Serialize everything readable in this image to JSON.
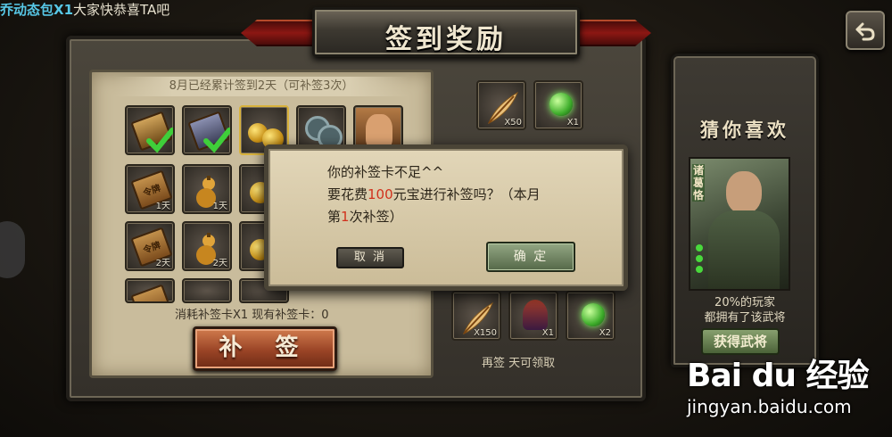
{
  "marquee": {
    "highlight": "乔动态包X1",
    "message": "大家快恭喜TA吧"
  },
  "title": "签到奖励",
  "checkin": {
    "banner": "8月已经累计签到2天（可补签3次）",
    "days": [
      "1天",
      "1天",
      "2天",
      "2天"
    ],
    "consume": "消耗补签卡X1  现有补签卡：0",
    "patch_button": "补 签"
  },
  "rewards": {
    "top_counts": [
      "X50",
      "X1"
    ],
    "bottom_counts": [
      "X150",
      "X1",
      "X2"
    ],
    "note": "再签  天可领取"
  },
  "side": {
    "title": "猜你喜欢",
    "hero_name": "诸葛恪",
    "percent_line1": "20%的玩家",
    "percent_line2": "都拥有了该武将",
    "get_button": "获得武将"
  },
  "dialog": {
    "line1": "你的补签卡不足^^",
    "line2_pre": "要花费",
    "line2_amount": "100",
    "line2_post": "元宝进行补签吗？（本月",
    "line3_pre": "第",
    "line3_num": "1",
    "line3_post": "次补签）",
    "cancel": "取 消",
    "confirm": "确 定"
  },
  "watermark": {
    "logo": "Bai du 经验",
    "url": "jingyan.baidu.com"
  },
  "colors": {
    "accent_red": "#d1311c",
    "marquee_blue": "#57c7e6",
    "title_red": "#8c1713"
  }
}
